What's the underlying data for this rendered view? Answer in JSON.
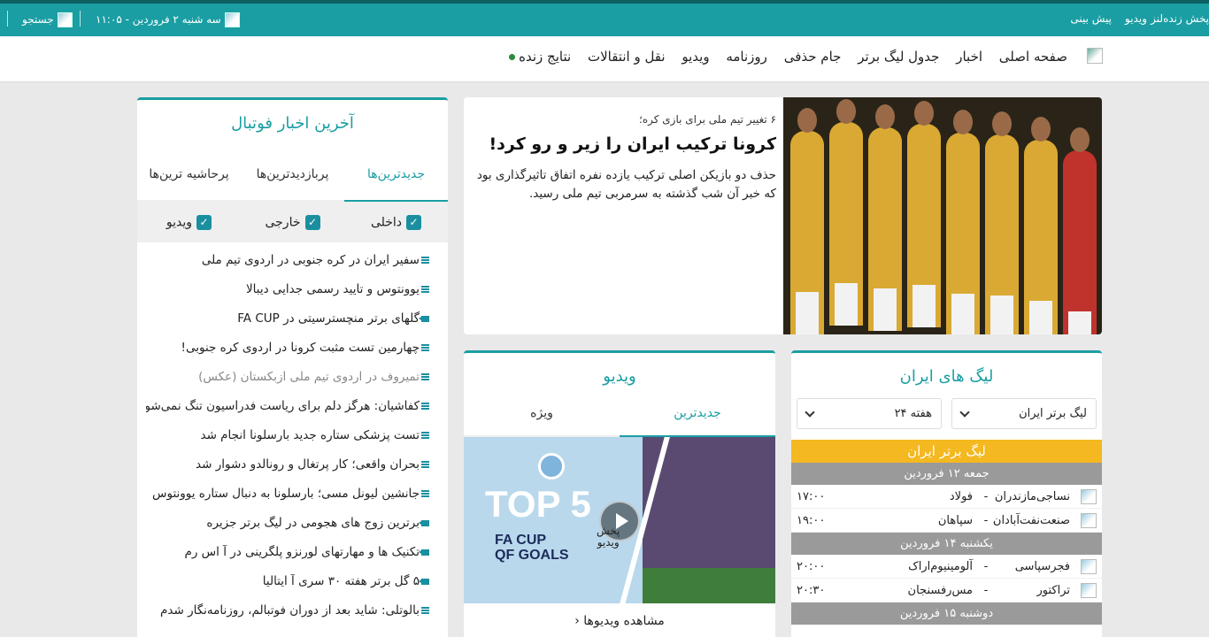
{
  "topbar": {
    "links": [
      "پیش بینی",
      "ویدیو",
      "لنز",
      "پخش زنده"
    ],
    "date": "سه شنبه ۲ فروردین - ۱۱:۰۵",
    "search": "جستجو"
  },
  "nav": {
    "items": [
      "صفحه اصلی",
      "اخبار",
      "جدول لیگ برتر",
      "جام حذفی",
      "روزنامه",
      "ویدیو",
      "نقل و انتقالات",
      "نتایج زنده"
    ]
  },
  "hero": {
    "subtitle": "۶ تغییر تیم ملی برای بازی کره؛",
    "title": "کرونا ترکیب ایران را زیر و رو کرد!",
    "description": "حذف دو بازیکن اصلی ترکیب یازده نفره اتفاق تاثیرگذاری بود که خبر آن شب گذشته به سرمربی تیم ملی رسید."
  },
  "news": {
    "title": "آخرین اخبار فوتبال",
    "tabs": [
      "جدیدترین‌ها",
      "پربازدیدترین‌ها",
      "پرحاشیه ترین‌ها"
    ],
    "filters": [
      "داخلی",
      "خارجی",
      "ویدیو"
    ],
    "items": [
      {
        "text": "سفیر ایران در کره جنوبی در اردوی تیم ملی",
        "icon": "text-icon"
      },
      {
        "text": "یوونتوس و تایید رسمی جدایی دیبالا",
        "icon": "text-icon"
      },
      {
        "text": "گلهای برتر منچسترسیتی در FA CUP",
        "icon": "video-icon"
      },
      {
        "text": "چهارمین تست مثبت کرونا در اردوی کره جنوبی!",
        "icon": "text-icon"
      },
      {
        "text": "تمیروف در اردوی تیم ملی ازبکستان (عکس)",
        "icon": "text-icon",
        "muted": true
      },
      {
        "text": "کفاشیان: هرگز دلم برای ریاست فدراسیون تنگ نمی‌شود",
        "icon": "text-icon"
      },
      {
        "text": "تست پزشکی ستاره جدید بارسلونا انجام شد",
        "icon": "text-icon"
      },
      {
        "text": "بحران واقعی؛ کار پرتغال و رونالدو دشوار شد",
        "icon": "text-icon"
      },
      {
        "text": "جانشین لیونل مسی؛ بارسلونا به دنبال ستاره یوونتوس",
        "icon": "text-icon"
      },
      {
        "text": "برترین زوج های هجومی در لیگ برتر جزیره",
        "icon": "video-icon"
      },
      {
        "text": "تکنیک ها و مهارتهای لورنزو پلگرینی در آ اس رم",
        "icon": "video-icon"
      },
      {
        "text": "۵ گل برتر هفته ۳۰ سری آ ایتالیا",
        "icon": "video-icon"
      },
      {
        "text": "بالوتلی: شاید بعد از دوران فوتبالم، روزنامه‌نگار شدم",
        "icon": "text-icon"
      }
    ]
  },
  "video": {
    "title": "ویدیو",
    "tabs": [
      "جدیدترین",
      "ویژه"
    ],
    "thumb_top": "TOP 5",
    "thumb_line1": "FA CUP",
    "thumb_line2": "QF GOALS",
    "play_label_1": "پخش",
    "play_label_2": "ویدیو",
    "more": "مشاهده ویدیوها"
  },
  "league": {
    "title": "لیگ های ایران",
    "select_league": "لیگ برتر ایران",
    "select_week": "هفته ۲۴",
    "league_name": "لیگ برتر ایران",
    "days": [
      {
        "label": "جمعه ۱۲ فروردین",
        "matches": [
          {
            "home": "نساجی‌مازندران",
            "away": "فولاد",
            "time": "۱۷:۰۰"
          },
          {
            "home": "صنعت‌نفت‌آبادان",
            "away": "سپاهان",
            "time": "۱۹:۰۰"
          }
        ]
      },
      {
        "label": "یکشنبه ۱۴ فروردین",
        "matches": [
          {
            "home": "فجرسپاسی",
            "away": "آلومینیوم‌اراک",
            "time": "۲۰:۰۰"
          },
          {
            "home": "تراکتور",
            "away": "مس‌رفسنجان",
            "time": "۲۰:۳۰"
          }
        ]
      },
      {
        "label": "دوشنبه ۱۵ فروردین",
        "matches": []
      }
    ]
  },
  "colors": {
    "teal": "#1a9ea3",
    "gold": "#f4b820",
    "gray": "#9a9a9a"
  }
}
